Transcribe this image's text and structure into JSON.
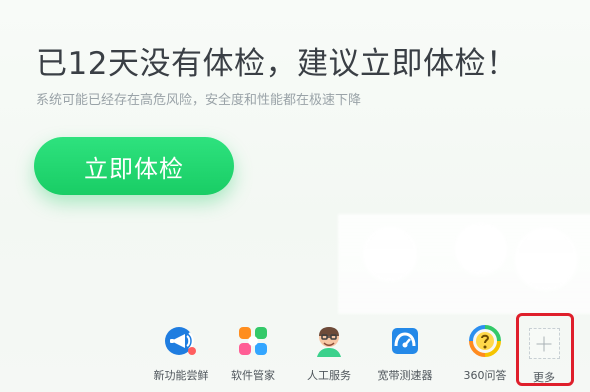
{
  "main": {
    "headline": "已12天没有体检，建议立即体检！",
    "subheadline": "系统可能已经存在高危风险，安全度和性能都在极速下降",
    "cta_label": "立即体检"
  },
  "tools": [
    {
      "label": "新功能尝鲜",
      "icon": "megaphone-icon"
    },
    {
      "label": "软件管家",
      "icon": "app-store-icon"
    },
    {
      "label": "人工服务",
      "icon": "support-agent-icon"
    },
    {
      "label": "宽带测速器",
      "icon": "speedometer-icon"
    },
    {
      "label": "360问答",
      "icon": "question-circle-icon"
    },
    {
      "label": "更多",
      "icon": "plus-icon"
    }
  ],
  "colors": {
    "primary_green": "#20D26C",
    "highlight_red": "#DF1F2B",
    "headline_text": "#3A3F45",
    "muted_text": "#9AA3A8"
  }
}
